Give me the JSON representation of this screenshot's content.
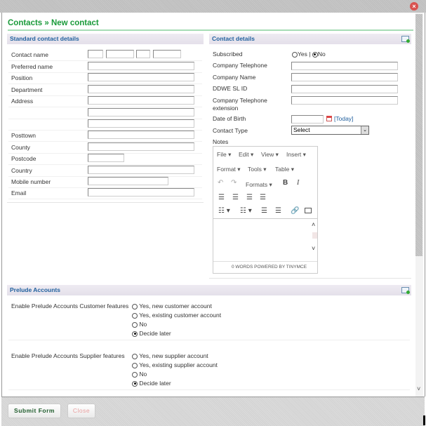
{
  "page_title": "Contacts » New contact",
  "standard": {
    "header": "Standard contact details",
    "labels": {
      "contact_name": "Contact name",
      "preferred_name": "Preferred name",
      "position": "Position",
      "department": "Department",
      "address": "Address",
      "posttown": "Posttown",
      "county": "County",
      "postcode": "Postcode",
      "country": "Country",
      "mobile": "Mobile number",
      "email": "Email"
    }
  },
  "contact": {
    "header": "Contact details",
    "subscribed": "Subscribed",
    "yes": "Yes",
    "sep": "|",
    "no": "No",
    "company_telephone": "Company Telephone",
    "company_name": "Company Name",
    "ddwe": "DDWE SL ID",
    "ext1": "Company Telephone",
    "ext2": "extension",
    "dob": "Date of Birth",
    "today": "[Today]",
    "contact_type": "Contact Type",
    "contact_type_value": "Select",
    "notes": "Notes"
  },
  "editor": {
    "menus": [
      "File",
      "Edit",
      "View",
      "Insert",
      "Format",
      "Tools",
      "Table"
    ],
    "formats": "Formats",
    "bold": "B",
    "italic": "I",
    "status": "0 WORDS POWERED BY TINYMCE"
  },
  "prelude": {
    "header": "Prelude Accounts",
    "customer": {
      "label": "Enable Prelude Accounts Customer features",
      "options": [
        "Yes, new customer account",
        "Yes, existing customer account",
        "No",
        "Decide later"
      ],
      "selected": "Decide later"
    },
    "supplier": {
      "label": "Enable Prelude Accounts Supplier features",
      "options": [
        "Yes, new supplier account",
        "Yes, existing supplier account",
        "No",
        "Decide later"
      ],
      "selected": "Decide later"
    }
  },
  "footer": {
    "submit": "Submit Form",
    "close": "Close"
  }
}
